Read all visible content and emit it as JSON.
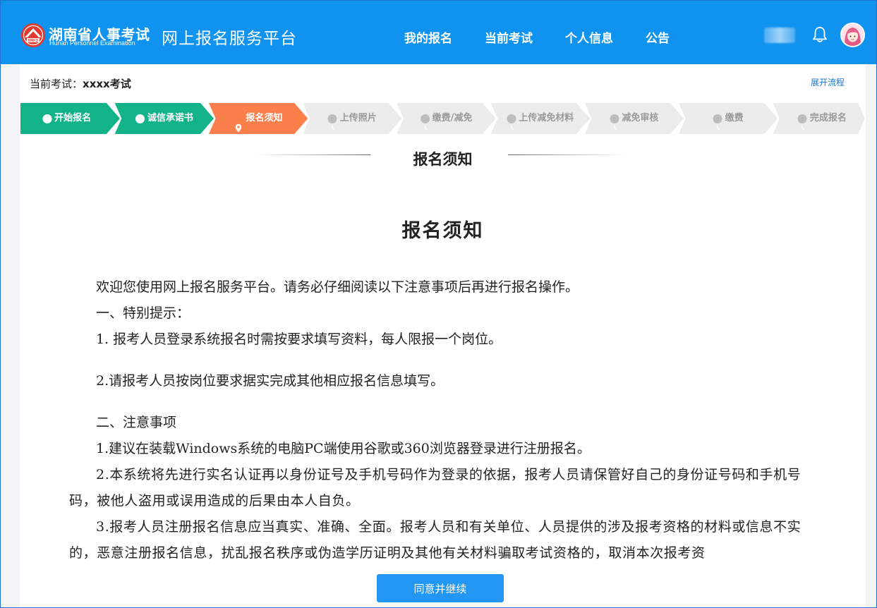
{
  "header": {
    "logo_cn": "湖南省人事考试",
    "logo_en": "Hunan Personnel Examination",
    "logo_mark": "HNKS",
    "platform": "网上报名服务平台",
    "nav": [
      "我的报名",
      "当前考试",
      "个人信息",
      "公告"
    ],
    "icons": [
      "bell-icon",
      "user-avatar"
    ]
  },
  "exam": {
    "label": "当前考试：",
    "name": "xxxx考试",
    "expand": "展开流程"
  },
  "steps": [
    {
      "label": "开始报名",
      "status": "done",
      "icon": "check-circle-icon"
    },
    {
      "label": "诚信承诺书",
      "status": "done",
      "icon": "check-circle-icon"
    },
    {
      "label": "报名须知",
      "status": "current",
      "icon": "location-pin-icon"
    },
    {
      "label": "上传照片",
      "status": "pending",
      "icon": "clock-icon"
    },
    {
      "label": "缴费/减免",
      "status": "pending",
      "icon": "clock-icon"
    },
    {
      "label": "上传减免材料",
      "status": "pending",
      "icon": "clock-icon"
    },
    {
      "label": "减免审核",
      "status": "pending",
      "icon": "clock-icon"
    },
    {
      "label": "缴费",
      "status": "pending",
      "icon": "clock-icon"
    },
    {
      "label": "完成报名",
      "status": "pending",
      "icon": "clock-icon"
    }
  ],
  "colors": {
    "header": "#1092ef",
    "done": "#13b38a",
    "current": "#fa7f4a",
    "pending": "#ececec",
    "button": "#2196f3"
  },
  "notice": {
    "section_title": "报名须知",
    "doc_title": "报名须知",
    "paragraphs": [
      "欢迎您使用网上报名服务平台。请务必仔细阅读以下注意事项后再进行报名操作。",
      "一、特别提示：",
      "1. 报考人员登录系统报名时需按要求填写资料，每人限报一个岗位。",
      "2.请报考人员按岗位要求据实完成其他相应报名信息填写。",
      "二、注意事项",
      "1.建议在装载Windows系统的电脑PC端使用谷歌或360浏览器登录进行注册报名。",
      "2.本系统将先进行实名认证再以身份证号及手机号码作为登录的依据，报考人员请保管好自己的身份证号码和手机号码，被他人盗用或误用造成的后果由本人自负。",
      "3.报考人员注册报名信息应当真实、准确、全面。报考人员和有关单位、人员提供的涉及报考资格的材料或信息不实的，恶意注册报名信息，扰乱报名秩序或伪造学历证明及其他有关材料骗取考试资格的，取消本次报考资"
    ]
  },
  "actions": {
    "agree": "同意并继续"
  }
}
